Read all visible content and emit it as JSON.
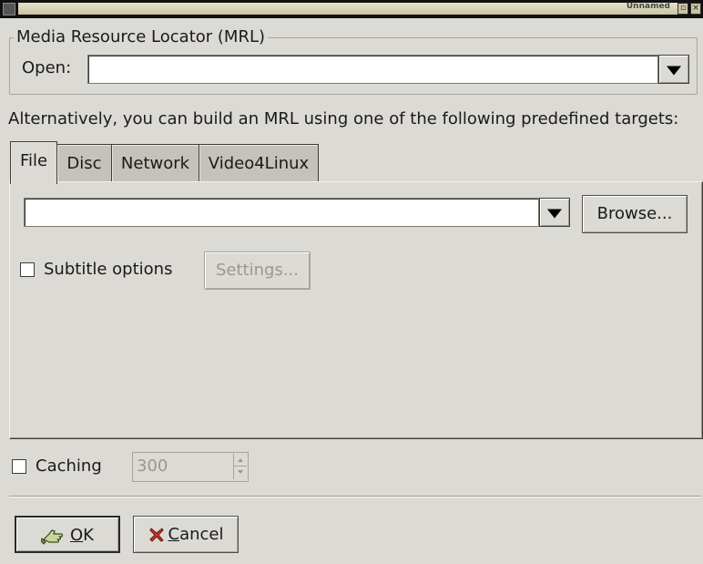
{
  "window": {
    "title": "Unnamed"
  },
  "mrl_frame": {
    "legend": "Media Resource Locator (MRL)",
    "open_label": "Open:",
    "open_value": ""
  },
  "alt_text": "Alternatively, you can build an MRL using one of the following predefined targets:",
  "tabs": [
    {
      "label": "File",
      "active": true
    },
    {
      "label": "Disc",
      "active": false
    },
    {
      "label": "Network",
      "active": false
    },
    {
      "label": "Video4Linux",
      "active": false
    }
  ],
  "file_tab": {
    "file_value": "",
    "browse_label": "Browse...",
    "subtitle_label": "Subtitle options",
    "subtitle_checked": false,
    "settings_label": "Settings..."
  },
  "caching": {
    "label": "Caching",
    "checked": false,
    "value": "300"
  },
  "buttons": {
    "ok_mnemonic": "O",
    "ok_rest": "K",
    "cancel_mnemonic": "C",
    "cancel_rest": "ancel"
  },
  "icons": {
    "ok": "ok-hand-icon",
    "cancel": "cancel-x-icon",
    "combo_arrow": "chevron-down-icon"
  },
  "colors": {
    "window_bg": "#dcdad5",
    "entry_bg": "#ffffff",
    "disabled_text": "#9a9892"
  }
}
